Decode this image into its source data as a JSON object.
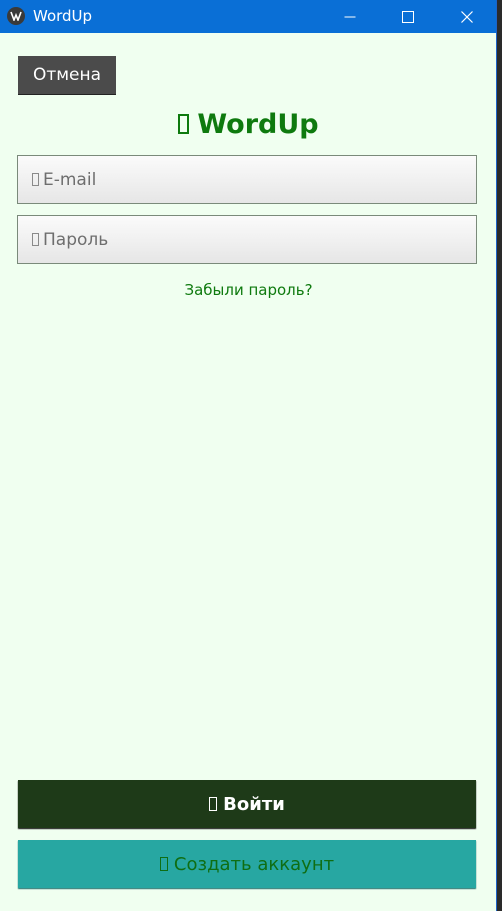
{
  "window": {
    "title": "WordUp",
    "app_icon": "kivy-logo-icon",
    "controls": [
      "minimize-icon",
      "maximize-icon",
      "close-icon"
    ]
  },
  "cancel_button": {
    "label": "Отмена"
  },
  "header": {
    "icon": "missing-glyph-icon",
    "title": "WordUp"
  },
  "email_field": {
    "icon": "missing-glyph-icon",
    "placeholder": "E-mail",
    "value": ""
  },
  "password_field": {
    "icon": "missing-glyph-icon",
    "placeholder": "Пароль",
    "value": ""
  },
  "forgot_link": {
    "label": "Забыли пароль?"
  },
  "login_button": {
    "icon": "missing-glyph-icon",
    "label": "Войти"
  },
  "create_account_button": {
    "icon": "missing-glyph-icon",
    "label": "Создать аккаунт"
  },
  "colors": {
    "titlebar": "#0a6fd6",
    "background": "#f0fff0",
    "accent_green": "#0e7a0e",
    "login_bg": "#1e3a18",
    "create_bg": "#27a7a2",
    "cancel_bg": "#4b4b4b"
  }
}
